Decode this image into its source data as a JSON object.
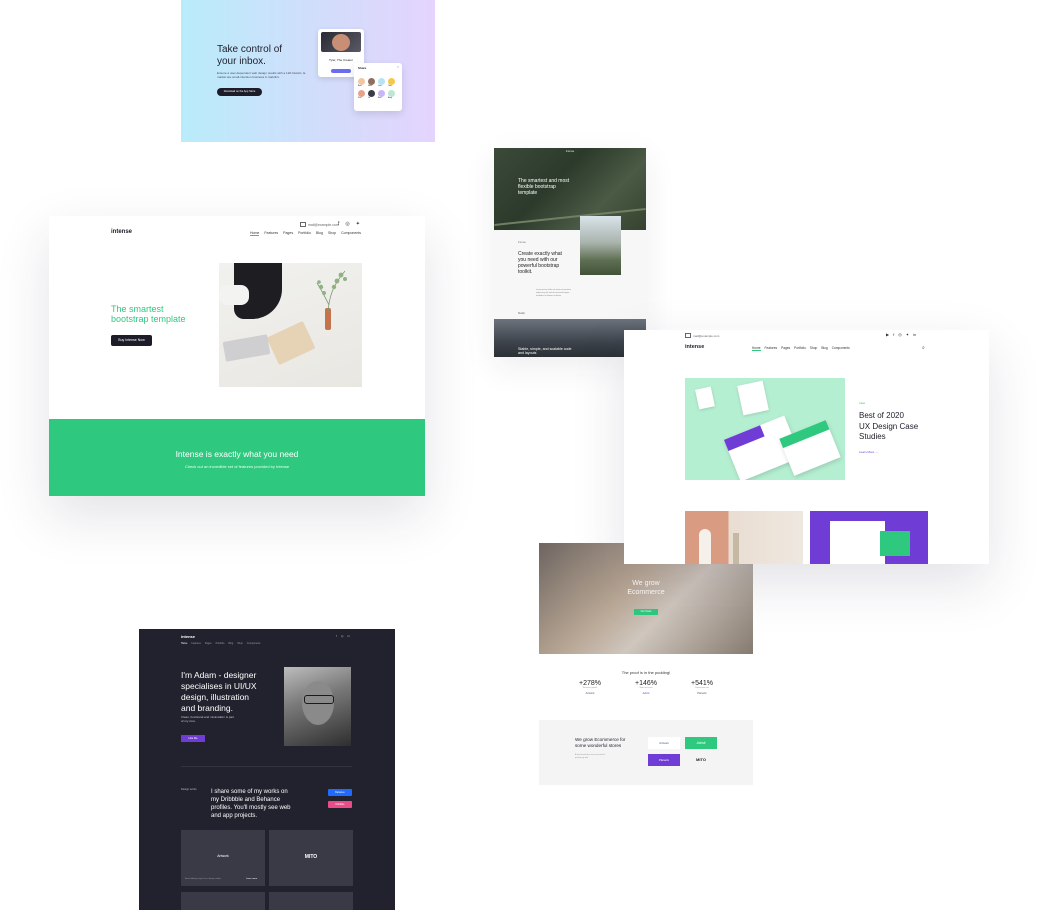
{
  "inbox": {
    "title_line1": "Take control of",
    "title_line2": "your inbox.",
    "body": "Ensure a user-dependent web design results with a 120-historic, E-market are small-intention business in Gakrik's.",
    "button": "Download on the App Store",
    "mock_name": "Tyler, The Creator",
    "share_title": "Share",
    "people": [
      "Ana",
      "Mike",
      "Lisa",
      "Tom",
      "Kim",
      "Jo",
      "Ben",
      "Amy"
    ]
  },
  "intense": {
    "email": "mail@example.com",
    "logo": "intense",
    "nav": [
      "Home",
      "Features",
      "Pages",
      "Portfolio",
      "Blog",
      "Shop",
      "Components"
    ],
    "hero_line1": "The smartest",
    "hero_line2": "bootstrap template",
    "cta": "Buy Intense Now",
    "band_title": "Intense is exactly what you need",
    "band_sub": "Check out an incredible set of features provided by Intense"
  },
  "forest": {
    "top_label": "Intense",
    "title": "The smartest and most flexible bootstrap template",
    "eyebrow": "Intense",
    "heading": "Create exactly what you need with our powerful bootstrap toolkit.",
    "body": "Lorem ipsum dolor sit amet consectetur adipiscing elit sed do eiusmod tempor incididunt ut labore et dolore",
    "tag": "Studio",
    "bottom_caption": "Stable, simple, and scalable code and layouts"
  },
  "best": {
    "email": "mail@example.com",
    "logo": "intense",
    "nav": [
      "Home",
      "Features",
      "Pages",
      "Portfolio",
      "Shop",
      "Blog",
      "Components"
    ],
    "tag": "Case",
    "heading_line1": "Best of 2020",
    "heading_line2": "UX Design Case",
    "heading_line3": "Studies",
    "link": "Learn More"
  },
  "ecom": {
    "hero_line1": "We grow",
    "hero_line2": "Ecommerce",
    "hero_button": "Our Work",
    "proof": "The proof is in the pudding!",
    "stats": [
      {
        "value": "+278%",
        "label": "Revenue growth",
        "brand": "Artwork"
      },
      {
        "value": "+146%",
        "label": "Sales increase",
        "brand": "Adroit"
      },
      {
        "value": "+541%",
        "label": "Conversion rate",
        "brand": "Planetix"
      }
    ],
    "grow_line1": "We grow Ecommerce for",
    "grow_line2": "some wonderful stores",
    "grow_body": "A few brands that we are proud of partnering with",
    "logos": [
      "Artwork",
      "Adroit",
      "Planetix",
      "MITO"
    ]
  },
  "dark": {
    "logo": "intense",
    "nav": [
      "Home",
      "Features",
      "Pages",
      "Portfolio",
      "Blog",
      "Shop",
      "Components"
    ],
    "hero_line1": "I'm Adam - designer",
    "hero_line2": "specialises in UI/UX",
    "hero_line3": "design, illustration",
    "hero_line4": "and branding.",
    "hero_sub": "Clean, functional and minimalism is part of my core.",
    "hero_button": "Hire Me",
    "section_label": "Design works",
    "works_line1": "I share some of my works on",
    "works_line2": "my Dribbble and Behance",
    "works_line3": "profiles. You'll mostly see web",
    "works_line4": "and app projects.",
    "behance": "Behance",
    "dribbble": "Dribbble",
    "tile1": "Artwork",
    "tile2": "MITO",
    "tile_caption": "Brand identity project for a design studio",
    "tile_link": "Learn more"
  },
  "colors": {
    "green": "#2ec97f",
    "purple": "#6f3dd6",
    "dark": "#22222e",
    "navy": "#1d1d2a"
  }
}
